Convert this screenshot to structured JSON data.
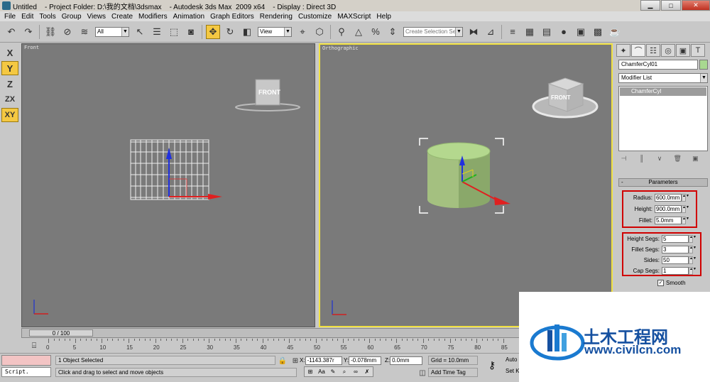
{
  "titlebar": {
    "title": "Untitled    - Project Folder: D:\\我的文档\\3dsmax    - Autodesk 3ds Max  2009 x64    - Display : Direct 3D"
  },
  "menu": [
    "File",
    "Edit",
    "Tools",
    "Group",
    "Views",
    "Create",
    "Modifiers",
    "Animation",
    "Graph Editors",
    "Rendering",
    "Customize",
    "MAXScript",
    "Help"
  ],
  "toolbar": {
    "selection_filter": "All",
    "ref_coord": "View",
    "named_selection_placeholder": "Create Selection Se"
  },
  "axis_constraints": [
    "X",
    "Y",
    "Z",
    "ZX",
    "XY"
  ],
  "viewports": {
    "left_label": "Front",
    "right_label": "Orthographic",
    "viewcube_text": "FRONT"
  },
  "command_panel": {
    "object_name": "ChamferCyl01",
    "modifier_list": "Modifier List",
    "stack_item": "ChamferCyl",
    "rollout_title": "Parameters",
    "radius_label": "Radius:",
    "radius_value": "600.0mm",
    "height_label": "Height:",
    "height_value": "900.0mm",
    "fillet_label": "Fillet:",
    "fillet_value": "5.0mm",
    "height_segs_label": "Height Segs:",
    "height_segs_value": "5",
    "fillet_segs_label": "Fillet Segs:",
    "fillet_segs_value": "3",
    "sides_label": "Sides:",
    "sides_value": "50",
    "cap_segs_label": "Cap Segs:",
    "cap_segs_value": "1",
    "smooth_label": "Smooth",
    "smooth_checked": true
  },
  "timeline": {
    "slider_text": "0 / 100",
    "ticks": [
      "0",
      "5",
      "10",
      "15",
      "20",
      "25",
      "30",
      "35",
      "40",
      "45",
      "50",
      "55",
      "60",
      "65",
      "70",
      "75",
      "80",
      "85"
    ]
  },
  "status": {
    "script_label": "Script.",
    "selection_text": "1 Object Selected",
    "prompt_text": "Click and drag to select and move objects",
    "x_label": "X:",
    "x_value": "-1143.387r",
    "y_label": "Y:",
    "y_value": "-0.078mm",
    "z_label": "Z:",
    "z_value": "0.0mm",
    "grid_text": "Grid = 10.0mm",
    "add_time_tag": "Add Time Tag",
    "auto_key": "Auto",
    "set_key": "Set K"
  },
  "watermark": {
    "name": "土木工程网",
    "url": "www.civilcn.com"
  }
}
